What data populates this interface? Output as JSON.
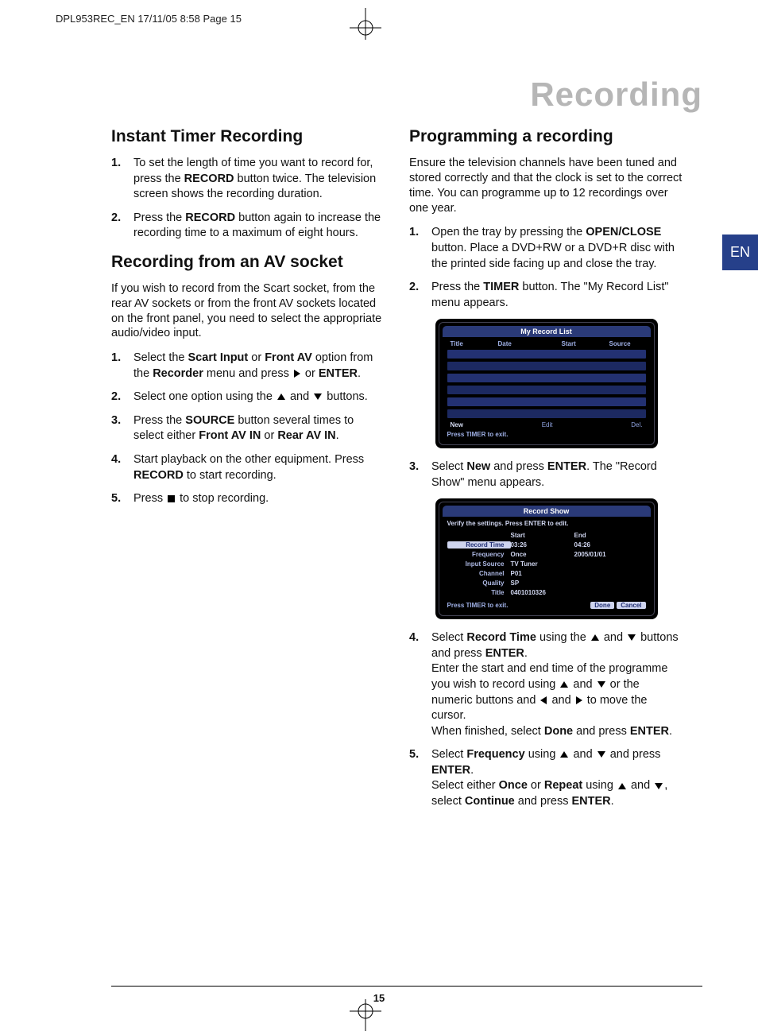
{
  "crop_header": "DPL953REC_EN  17/11/05  8:58  Page 15",
  "page_title": "Recording",
  "lang_tab": "EN",
  "page_number": "15",
  "left": {
    "h1": "Instant Timer Recording",
    "s1_items": [
      "To set the length of time you want to record for, press the <b>RECORD</b> button twice. The television screen shows the recording duration.",
      "Press the <b>RECORD</b> button again to increase the recording time to a maximum of eight hours."
    ],
    "h2": "Recording from an AV socket",
    "s2_intro": "If you wish to record from the Scart socket, from the rear AV sockets or from the front AV sockets located on the front panel, you need to select the appropriate audio/video input.",
    "s2_items": [
      "Select the <b>Scart Input</b> or <b>Front AV</b> option from the <b>Recorder</b> menu and press {R} or <b>ENTER</b>.",
      "Select one option using the {U} and {D} buttons.",
      "Press the <b>SOURCE</b> button several times to select either <b>Front AV IN</b> or <b>Rear AV IN</b>.",
      "Start playback on the other equipment. Press <b>RECORD</b> to start recording.",
      "Press {S} to stop recording."
    ]
  },
  "right": {
    "h1": "Programming a recording",
    "intro": "Ensure the television channels have been tuned and stored correctly and that the clock is set to the correct time. You can programme up to 12 recordings over one year.",
    "items": [
      "Open the tray by pressing the <b>OPEN/CLOSE</b> button. Place a DVD+RW or a DVD+R disc with the printed side facing up and close the tray.",
      "Press the <b>TIMER</b> button. The \"My Record List\" menu appears.",
      "Select <b>New</b> and press <b>ENTER</b>. The \"Record Show\" menu appears.",
      "Select <b>Record Time</b> using the {U} and {D} buttons and press <b>ENTER</b>.<br>Enter the start and end time of the programme you wish to record using {U} and {D} or the numeric buttons and {L} and {R} to move the cursor.<br>When finished, select <b>Done</b> and press <b>ENTER</b>.",
      "Select <b>Frequency</b> using {U} and {D} and press <b>ENTER</b>.<br>Select either <b>Once</b> or <b>Repeat</b> using {U} and {D}, select <b>Continue</b> and press <b>ENTER</b>."
    ]
  },
  "screen1": {
    "title": "My Record List",
    "cols": {
      "c1": "Title",
      "c2": "Date",
      "c3": "Start",
      "c4": "Source"
    },
    "ftr": {
      "new": "New",
      "edit": "Edit",
      "del": "Del."
    },
    "exit": "Press TIMER to exit."
  },
  "screen2": {
    "title": "Record Show",
    "verify": "Verify the settings. Press ENTER to edit.",
    "head": {
      "blank": "",
      "start": "Start",
      "end": "End"
    },
    "rows": [
      {
        "label": "Record Time",
        "v1": "03:26",
        "v2": "04:26",
        "sel": true
      },
      {
        "label": "Frequency",
        "v1": "Once",
        "v2": "2005/01/01"
      },
      {
        "label": "Input Source",
        "v1": "TV Tuner",
        "v2": ""
      },
      {
        "label": "Channel",
        "v1": "P01",
        "v2": ""
      },
      {
        "label": "Quality",
        "v1": "SP",
        "v2": ""
      },
      {
        "label": "Title",
        "v1": "0401010326",
        "v2": ""
      }
    ],
    "exit": "Press TIMER to exit.",
    "done": "Done",
    "cancel": "Cancel"
  }
}
